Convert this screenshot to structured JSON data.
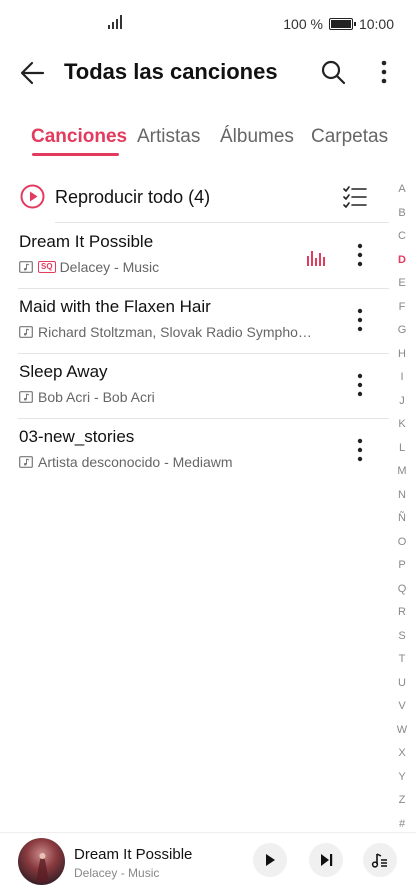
{
  "status": {
    "battery_text": "100 %",
    "time": "10:00"
  },
  "header": {
    "title": "Todas las canciones"
  },
  "tabs": [
    {
      "label": "Canciones"
    },
    {
      "label": "Artistas"
    },
    {
      "label": "Álbumes"
    },
    {
      "label": "Carpetas"
    }
  ],
  "play_all": {
    "label": "Reproducir todo (4)"
  },
  "songs": [
    {
      "title": "Dream It Possible",
      "subtitle": "Delacey - Music",
      "badge": "SQ",
      "playing": true
    },
    {
      "title": "Maid with the Flaxen Hair",
      "subtitle": "Richard Stoltzman, Slovak Radio Sympho…"
    },
    {
      "title": "Sleep Away",
      "subtitle": "Bob Acri - Bob Acri"
    },
    {
      "title": "03-new_stories",
      "subtitle": "Artista desconocido - Mediawm"
    }
  ],
  "index_letters": [
    "A",
    "B",
    "C",
    "D",
    "E",
    "F",
    "G",
    "H",
    "I",
    "J",
    "K",
    "L",
    "M",
    "N",
    "Ñ",
    "O",
    "P",
    "Q",
    "R",
    "S",
    "T",
    "U",
    "V",
    "W",
    "X",
    "Y",
    "Z",
    "#"
  ],
  "index_active": "D",
  "mini_player": {
    "title": "Dream It Possible",
    "artist": "Delacey - Music"
  },
  "colors": {
    "accent": "#e33b5e"
  }
}
